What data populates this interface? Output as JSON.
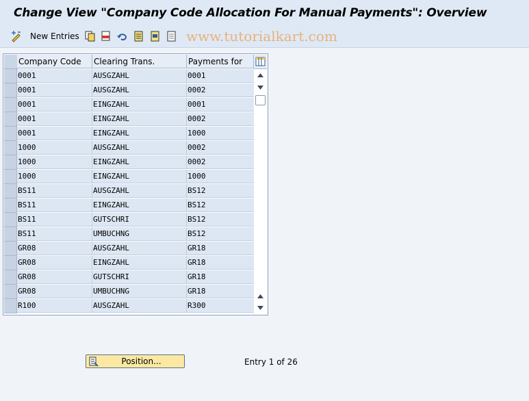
{
  "title": "Change View \"Company Code Allocation For Manual Payments\": Overview",
  "watermark": "www.tutorialkart.com",
  "toolbar": {
    "new_entries_label": "New Entries",
    "icons": [
      "display-change-icon",
      "copy-icon",
      "delete-icon",
      "undo-icon",
      "select-all-icon",
      "select-block-icon",
      "deselect-all-icon"
    ]
  },
  "table": {
    "columns": [
      "Company Code",
      "Clearing Trans.",
      "Payments for"
    ],
    "rows": [
      [
        "0001",
        "AUSGZAHL",
        "0001"
      ],
      [
        "0001",
        "AUSGZAHL",
        "0002"
      ],
      [
        "0001",
        "EINGZAHL",
        "0001"
      ],
      [
        "0001",
        "EINGZAHL",
        "0002"
      ],
      [
        "0001",
        "EINGZAHL",
        "1000"
      ],
      [
        "1000",
        "AUSGZAHL",
        "0002"
      ],
      [
        "1000",
        "EINGZAHL",
        "0002"
      ],
      [
        "1000",
        "EINGZAHL",
        "1000"
      ],
      [
        "BS11",
        "AUSGZAHL",
        "BS12"
      ],
      [
        "BS11",
        "EINGZAHL",
        "BS12"
      ],
      [
        "BS11",
        "GUTSCHRI",
        "BS12"
      ],
      [
        "BS11",
        "UMBUCHNG",
        "BS12"
      ],
      [
        "GR08",
        "AUSGZAHL",
        "GR18"
      ],
      [
        "GR08",
        "EINGZAHL",
        "GR18"
      ],
      [
        "GR08",
        "GUTSCHRI",
        "GR18"
      ],
      [
        "GR08",
        "UMBUCHNG",
        "GR18"
      ],
      [
        "R100",
        "AUSGZAHL",
        "R300"
      ]
    ]
  },
  "footer": {
    "position_button_label": "Position...",
    "entry_text": "Entry 1 of 26"
  }
}
